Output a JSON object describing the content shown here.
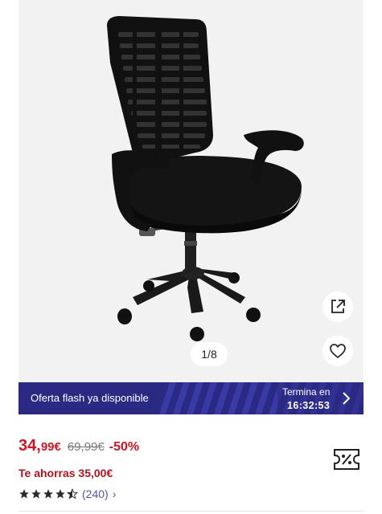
{
  "gallery": {
    "counter": "1/8",
    "image_alt": "office-chair"
  },
  "flash": {
    "label": "Oferta flash ya disponible",
    "ends_label": "Termina en",
    "timer": "16:32:53",
    "bg_color": "#2a2a84"
  },
  "price": {
    "current_int": "34,",
    "current_dec": "99€",
    "old": "69,99€",
    "discount": "-50%",
    "savings": "Te ahorras 35,00€",
    "accent_color": "#d6131f"
  },
  "rating": {
    "stars": 4.5,
    "count": "(240)",
    "chevron": "›"
  },
  "icons": {
    "share": "share-external-icon",
    "favorite": "heart-icon",
    "coupon": "coupon-icon",
    "chevron": "chevron-right-icon"
  }
}
